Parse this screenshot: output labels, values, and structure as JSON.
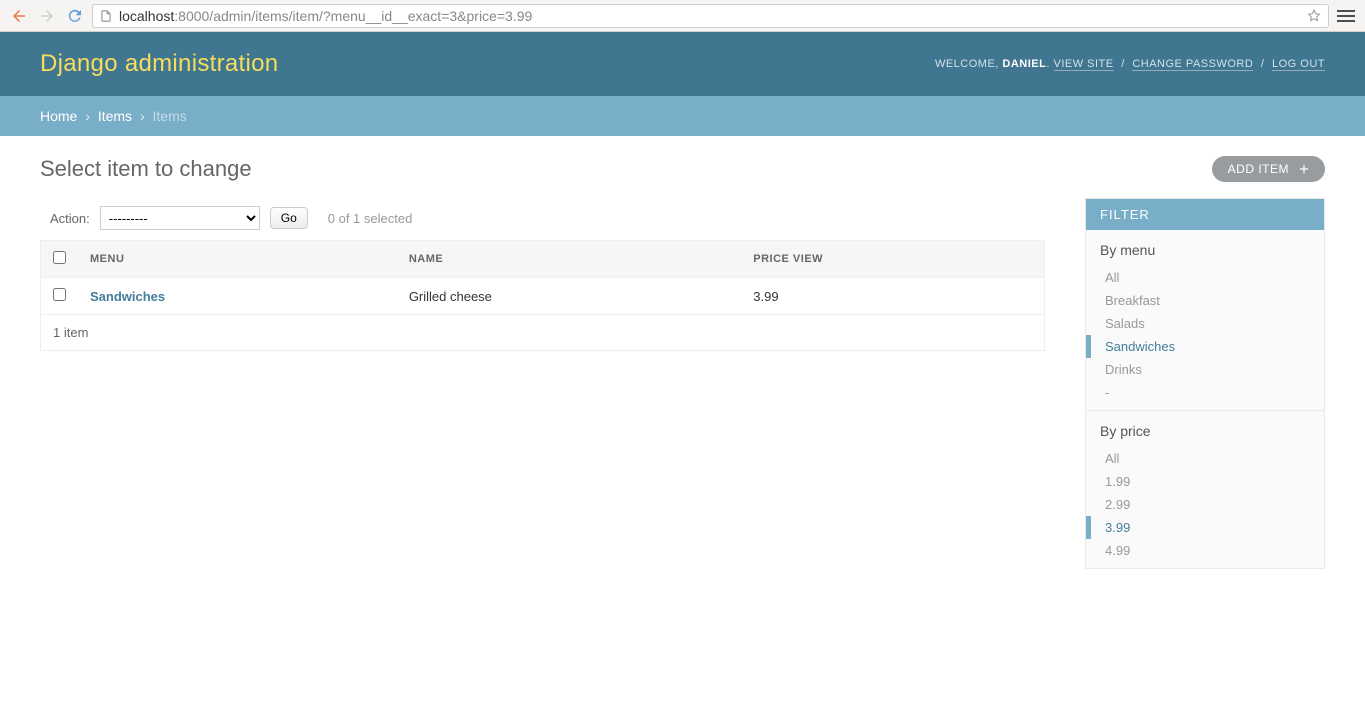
{
  "browser": {
    "url_host": "localhost",
    "url_path": ":8000/admin/items/item/?menu__id__exact=3&price=3.99"
  },
  "header": {
    "site_title": "Django administration",
    "welcome": "WELCOME,",
    "username": "DANIEL",
    "view_site": "VIEW SITE",
    "change_password": "CHANGE PASSWORD",
    "logout": "LOG OUT"
  },
  "breadcrumbs": {
    "home": "Home",
    "app": "Items",
    "model": "Items"
  },
  "page": {
    "title": "Select item to change",
    "add_label": "ADD ITEM"
  },
  "actions": {
    "label": "Action:",
    "placeholder": "---------",
    "go": "Go",
    "selection": "0 of 1 selected"
  },
  "table": {
    "headers": {
      "menu": "MENU",
      "name": "NAME",
      "price": "PRICE VIEW"
    },
    "rows": [
      {
        "menu": "Sandwiches",
        "name": "Grilled cheese",
        "price": "3.99"
      }
    ],
    "paginator": "1 item"
  },
  "filter": {
    "title": "FILTER",
    "by_menu_label": "By menu",
    "by_menu": [
      {
        "label": "All",
        "selected": false
      },
      {
        "label": "Breakfast",
        "selected": false
      },
      {
        "label": "Salads",
        "selected": false
      },
      {
        "label": "Sandwiches",
        "selected": true
      },
      {
        "label": "Drinks",
        "selected": false
      },
      {
        "label": "-",
        "selected": false
      }
    ],
    "by_price_label": "By price",
    "by_price": [
      {
        "label": "All",
        "selected": false
      },
      {
        "label": "1.99",
        "selected": false
      },
      {
        "label": "2.99",
        "selected": false
      },
      {
        "label": "3.99",
        "selected": true
      },
      {
        "label": "4.99",
        "selected": false
      }
    ]
  }
}
